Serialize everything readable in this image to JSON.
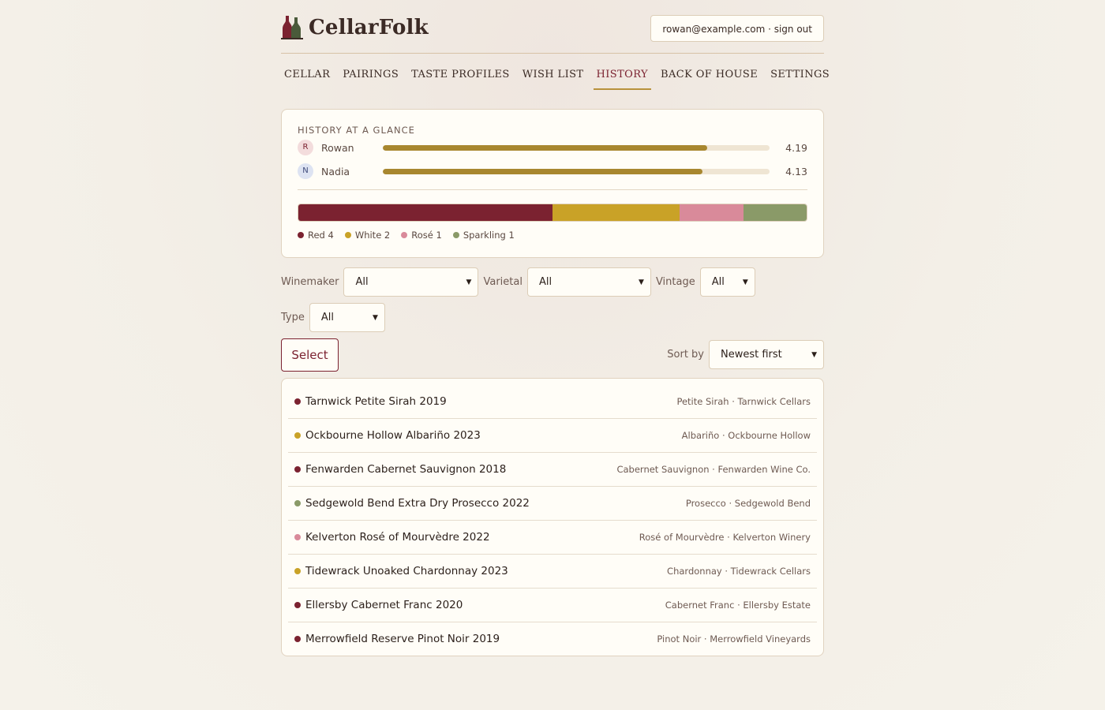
{
  "app": {
    "title": "CellarFolk",
    "account_label": "rowan@example.com · sign out"
  },
  "nav": [
    {
      "label": "CELLAR",
      "active": false
    },
    {
      "label": "PAIRINGS",
      "active": false
    },
    {
      "label": "TASTE PROFILES",
      "active": false
    },
    {
      "label": "WISH LIST",
      "active": false
    },
    {
      "label": "HISTORY",
      "active": true
    },
    {
      "label": "BACK OF HOUSE",
      "active": false
    },
    {
      "label": "SETTINGS",
      "active": false
    }
  ],
  "glance": {
    "title": "HISTORY AT A GLANCE",
    "people": [
      {
        "initial": "R",
        "name": "Rowan",
        "score": "4.19",
        "fraction": 0.838,
        "avatar_bg": "#f3dcdc",
        "avatar_fg": "#7b2230"
      },
      {
        "initial": "N",
        "name": "Nadia",
        "score": "4.13",
        "fraction": 0.826,
        "avatar_bg": "#dde3f2",
        "avatar_fg": "#3d4a7a"
      }
    ],
    "types": [
      {
        "label": "Red 4",
        "count": 4,
        "color": "#7b2230"
      },
      {
        "label": "White 2",
        "count": 2,
        "color": "#c9a227"
      },
      {
        "label": "Rosé 1",
        "count": 1,
        "color": "#d98a9a"
      },
      {
        "label": "Sparkling 1",
        "count": 1,
        "color": "#8a9a68"
      }
    ]
  },
  "filters": {
    "winemaker": {
      "label": "Winemaker",
      "value": "All"
    },
    "varietal": {
      "label": "Varietal",
      "value": "All"
    },
    "vintage": {
      "label": "Vintage",
      "value": "All"
    },
    "type": {
      "label": "Type",
      "value": "All"
    }
  },
  "toolbar": {
    "select_label": "Select",
    "sort_label": "Sort by",
    "sort_value": "Newest first"
  },
  "wines": [
    {
      "name": "Tarnwick Petite Sirah 2019",
      "meta": "Petite Sirah · Tarnwick Cellars",
      "color": "#7b2230"
    },
    {
      "name": "Ockbourne Hollow Albariño 2023",
      "meta": "Albariño · Ockbourne Hollow",
      "color": "#c9a227"
    },
    {
      "name": "Fenwarden Cabernet Sauvignon 2018",
      "meta": "Cabernet Sauvignon · Fenwarden Wine Co.",
      "color": "#7b2230"
    },
    {
      "name": "Sedgewold Bend Extra Dry Prosecco 2022",
      "meta": "Prosecco · Sedgewold Bend",
      "color": "#8a9a68"
    },
    {
      "name": "Kelverton Rosé of Mourvèdre 2022",
      "meta": "Rosé of Mourvèdre · Kelverton Winery",
      "color": "#d98a9a"
    },
    {
      "name": "Tidewrack Unoaked Chardonnay 2023",
      "meta": "Chardonnay · Tidewrack Cellars",
      "color": "#c9a227"
    },
    {
      "name": "Ellersby Cabernet Franc 2020",
      "meta": "Cabernet Franc · Ellersby Estate",
      "color": "#7b2230"
    },
    {
      "name": "Merrowfield Reserve Pinot Noir 2019",
      "meta": "Pinot Noir · Merrowfield Vineyards",
      "color": "#7b2230"
    }
  ]
}
